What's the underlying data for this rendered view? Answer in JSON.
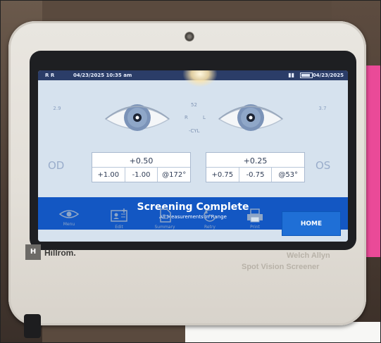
{
  "status": {
    "left_code": "R R",
    "left_datetime": "04/23/2025 10:35 am",
    "right_date": "04/23/2025"
  },
  "eyes": {
    "right": {
      "side": "OD",
      "label": "R",
      "pd_top": "2.9",
      "sph": "+0.50",
      "values": [
        "+1.00",
        "-1.00",
        "@172°"
      ]
    },
    "left": {
      "side": "OS",
      "label": "L",
      "pd_top": "3.7",
      "sph": "+0.25",
      "values": [
        "+0.75",
        "-0.75",
        "@53°"
      ]
    },
    "center_top": "52",
    "center_cyl": "-CYL"
  },
  "banner": {
    "title": "Screening Complete",
    "subtitle": "All Measurements In Range"
  },
  "nav": {
    "menu": "Menu",
    "edit": "Edit",
    "summary": "Summary",
    "retry": "Retry",
    "print": "Print",
    "home": "HOME"
  },
  "device": {
    "brand": "Hillrom.",
    "model_line1": "Welch Allyn",
    "model_line2": "Spot Vision Screener"
  },
  "colors": {
    "banner": "#1357c3",
    "home": "#1f6fd6",
    "screen_bg": "#d6e2ee",
    "status_bar": "#2b3d68"
  }
}
